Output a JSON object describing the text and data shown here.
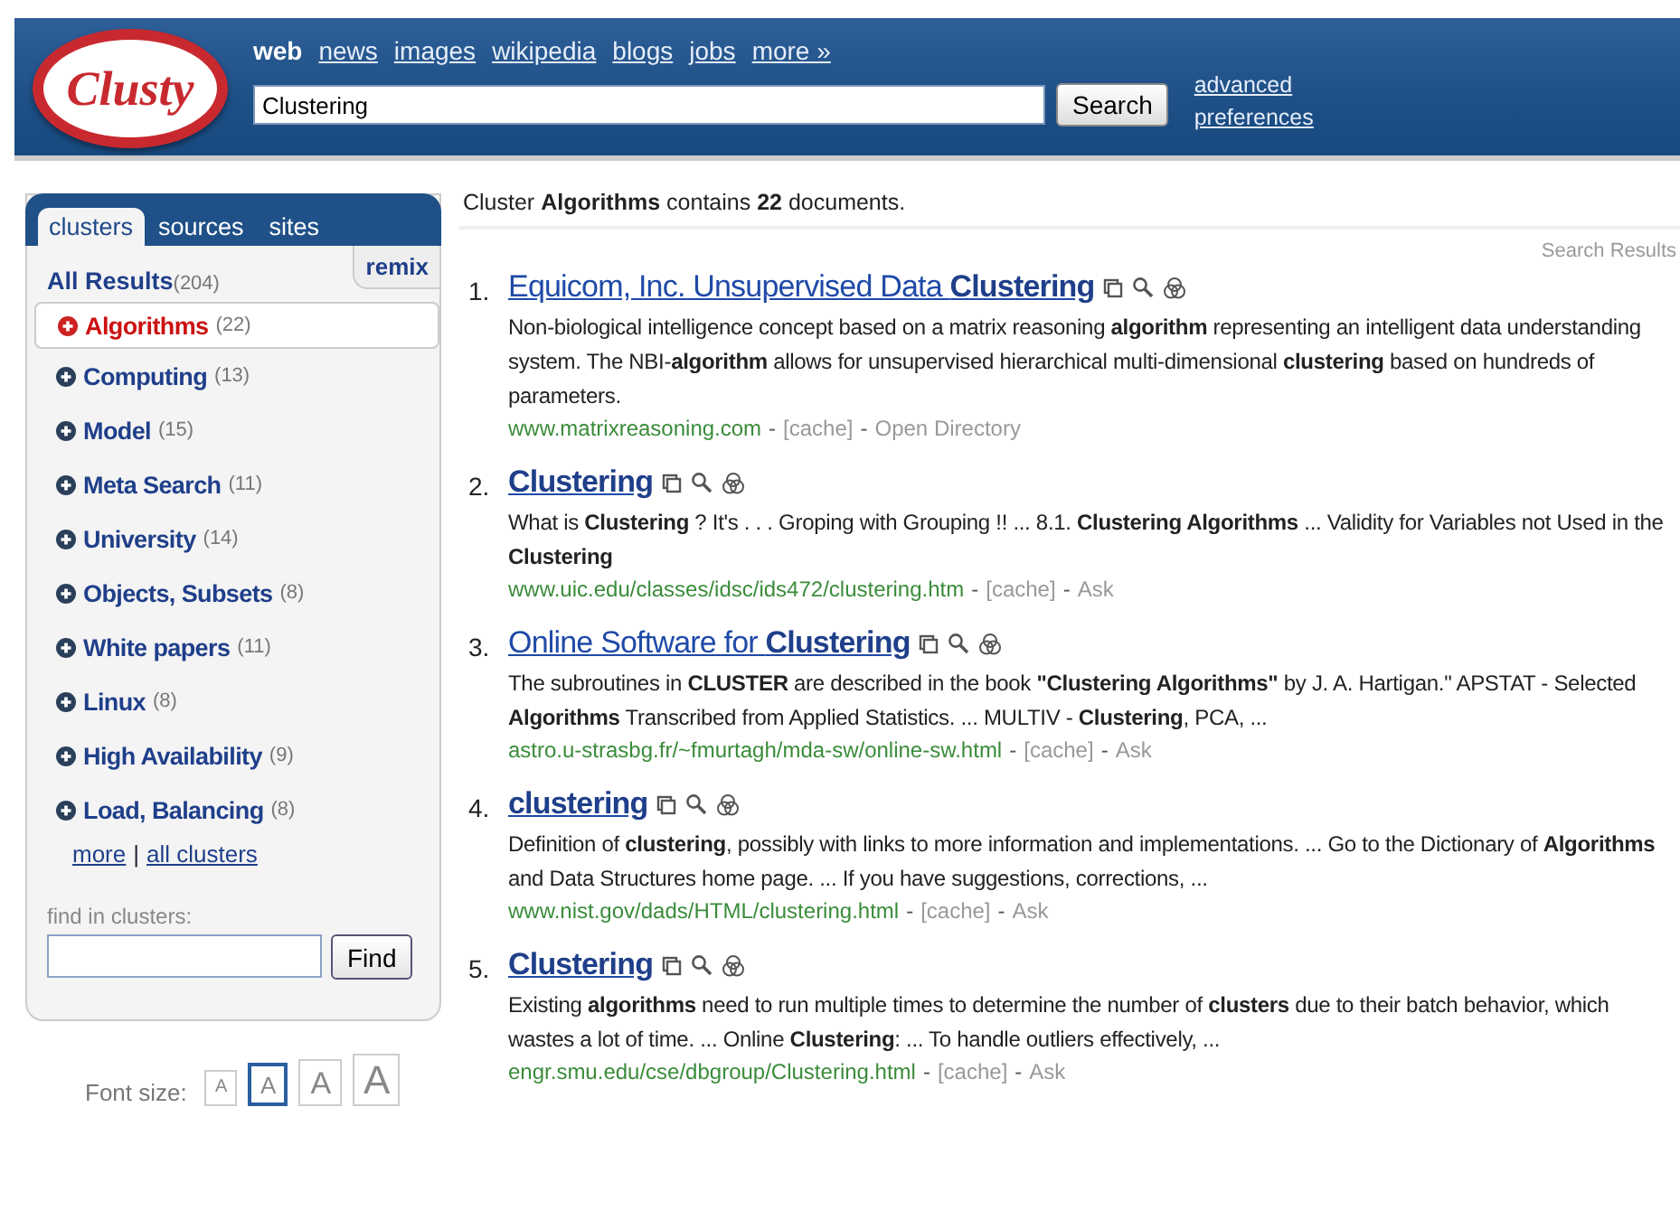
{
  "logo": "Clusty",
  "nav": [
    {
      "label": "web",
      "selected": true
    },
    {
      "label": "news",
      "selected": false
    },
    {
      "label": "images",
      "selected": false
    },
    {
      "label": "wikipedia",
      "selected": false
    },
    {
      "label": "blogs",
      "selected": false
    },
    {
      "label": "jobs",
      "selected": false
    },
    {
      "label": "more »",
      "selected": false
    }
  ],
  "search": {
    "value": "Clustering",
    "button": "Search"
  },
  "header_links": [
    "advanced",
    "preferences"
  ],
  "sidebar": {
    "tabs": [
      {
        "label": "clusters",
        "selected": true
      },
      {
        "label": "sources",
        "selected": false
      },
      {
        "label": "sites",
        "selected": false
      }
    ],
    "remix": "remix",
    "all_results": {
      "label": "All Results",
      "count": "(204)"
    },
    "clusters": [
      {
        "label": "Algorithms",
        "count": "(22)",
        "selected": true
      },
      {
        "label": "Computing",
        "count": "(13)",
        "selected": false
      },
      {
        "label": "Model",
        "count": "(15)",
        "selected": false
      },
      {
        "label": "Meta Search",
        "count": "(11)",
        "selected": false
      },
      {
        "label": "University",
        "count": "(14)",
        "selected": false
      },
      {
        "label": "Objects, Subsets",
        "count": "(8)",
        "selected": false
      },
      {
        "label": "White papers",
        "count": "(11)",
        "selected": false
      },
      {
        "label": "Linux",
        "count": "(8)",
        "selected": false
      },
      {
        "label": "High Availability",
        "count": "(9)",
        "selected": false
      },
      {
        "label": "Load, Balancing",
        "count": "(8)",
        "selected": false
      }
    ],
    "more_links": [
      "more",
      "all clusters"
    ],
    "link_separator": "|",
    "find": {
      "label": "find in clusters:",
      "button": "Find"
    }
  },
  "font_size": {
    "label": "Font size:",
    "options": [
      {
        "label": "A",
        "selected": false
      },
      {
        "label": "A",
        "selected": true
      },
      {
        "label": "A",
        "selected": false
      },
      {
        "label": "A",
        "selected": false
      }
    ]
  },
  "summary": "Cluster **Algorithms** contains **22** documents.",
  "results_label": "Search Results",
  "separator": "-",
  "results": [
    {
      "number": "1.",
      "title": "Equicom, Inc. Unsupervised Data **Clustering**",
      "snippet": "Non-biological intelligence concept based on a matrix reasoning **algorithm** representing an intelligent data understanding system. The NBI-**algorithm** allows for unsupervised hierarchical multi-dimensional **clustering** based on hundreds of parameters.",
      "url": "www.matrixreasoning.com",
      "cache": "[cache]",
      "source": "Open Directory"
    },
    {
      "number": "2.",
      "title": "**Clustering**",
      "snippet": "What is **Clustering** ? It's . . . Groping with Grouping !! ... 8.1. **Clustering Algorithms** ... Validity for Variables not Used in the **Clustering**",
      "url": "www.uic.edu/classes/idsc/ids472/clustering.htm",
      "cache": "[cache]",
      "source": "Ask"
    },
    {
      "number": "3.",
      "title": "Online Software for **Clustering**",
      "snippet": "The subroutines in **CLUSTER** are described in the book **\"Clustering Algorithms\"** by J. A. Hartigan.\" APSTAT - Selected **Algorithms** Transcribed from Applied Statistics. ... MULTIV - **Clustering**, PCA, ...",
      "url": "astro.u-strasbg.fr/~fmurtagh/mda-sw/online-sw.html",
      "cache": "[cache]",
      "source": "Ask"
    },
    {
      "number": "4.",
      "title": "**clustering**",
      "snippet": "Definition of **clustering**, possibly with links to more information and implementations. ... Go to the Dictionary of **Algorithms** and Data Structures home page. ... If you have suggestions, corrections, ...",
      "url": "www.nist.gov/dads/HTML/clustering.html",
      "cache": "[cache]",
      "source": "Ask"
    },
    {
      "number": "5.",
      "title": "**Clustering**",
      "snippet": "Existing **algorithms** need to run multiple times to determine the number of **clusters** due to their batch behavior, which wastes a lot of time. ... Online **Clustering**: ... To handle outliers effectively, ...",
      "url": "engr.smu.edu/cse/dbgroup/Clustering.html",
      "cache": "[cache]",
      "source": "Ask"
    }
  ]
}
